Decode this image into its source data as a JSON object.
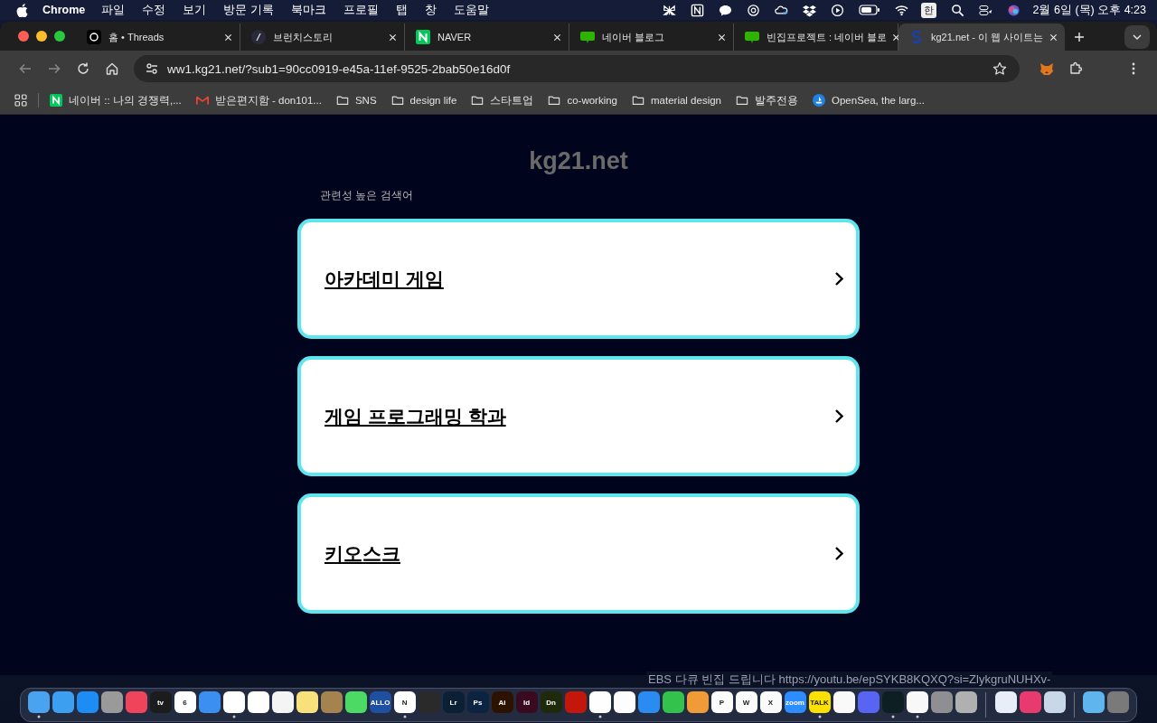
{
  "menu_bar": {
    "app": "Chrome",
    "items": [
      "파일",
      "수정",
      "보기",
      "방문 기록",
      "북마크",
      "프로필",
      "탭",
      "창",
      "도움말"
    ],
    "input_source": "한",
    "clock": "2월 6일 (목) 오후 4:23"
  },
  "tabs": [
    {
      "kind": "threads",
      "title": "홈 • Threads",
      "selected": false
    },
    {
      "kind": "brunch",
      "title": "브런치스토리",
      "selected": false
    },
    {
      "kind": "naver",
      "title": "NAVER",
      "selected": false
    },
    {
      "kind": "blog",
      "title": "네이버 블로그",
      "selected": false
    },
    {
      "kind": "blog",
      "title": "빈집프로젝트 : 네이버 블로",
      "selected": false
    },
    {
      "kind": "site",
      "title": "kg21.net - 이 웹 사이트는",
      "selected": true
    }
  ],
  "address_bar": {
    "url": "ww1.kg21.net/?sub1=90cc0919-e45a-11ef-9525-2bab50e16d0f"
  },
  "bookmarks": [
    {
      "kind": "naver",
      "title": "네이버 :: 나의 경쟁력,..."
    },
    {
      "kind": "gmail",
      "title": "받은편지함 - don101..."
    },
    {
      "kind": "folder",
      "title": "SNS"
    },
    {
      "kind": "folder",
      "title": "design life"
    },
    {
      "kind": "folder",
      "title": "스타트업"
    },
    {
      "kind": "folder",
      "title": "co-working"
    },
    {
      "kind": "folder",
      "title": "material design"
    },
    {
      "kind": "folder",
      "title": "발주전용"
    },
    {
      "kind": "opensea",
      "title": "OpenSea, the larg..."
    }
  ],
  "page": {
    "site_title": "kg21.net",
    "section_label": "관련성 높은 검색어",
    "results": [
      "아카데미 게임",
      "게임 프로그래밍 학과",
      "키오스크"
    ]
  },
  "background_window": {
    "bullet_text": "EBS 다큐 빈집 드립니다 https://youtu.be/epSYKB8KQXQ?si=ZlykgruNUHXv-"
  },
  "dock": {
    "groups": [
      [
        {
          "color": "#4aa3f0",
          "running": true
        },
        {
          "color": "#3d9ff0",
          "running": false
        },
        {
          "color": "#1d8cf5",
          "running": false
        },
        {
          "color": "#9a9a9a",
          "running": false
        },
        {
          "color": "#f0445a",
          "running": false
        },
        {
          "color": "#1c1c1c",
          "label": "tv",
          "running": false
        },
        {
          "color": "#ffffff",
          "label": "6",
          "running": false
        },
        {
          "color": "#3b8ff0",
          "running": false
        },
        {
          "color": "#ffffff",
          "running": true
        },
        {
          "color": "#ffffff",
          "running": false
        },
        {
          "color": "#f4f4f4",
          "running": false
        },
        {
          "color": "#f8e07a",
          "running": false
        },
        {
          "color": "#a5834f",
          "running": false
        },
        {
          "color": "#4cd964",
          "running": false
        },
        {
          "color": "#1f4fa0",
          "label": "ALLO",
          "running": false
        },
        {
          "color": "#ffffff",
          "label": "N",
          "running": true
        },
        {
          "color": "#2a2a2a",
          "running": false
        },
        {
          "color": "#0b2034",
          "label": "Lr",
          "running": false
        },
        {
          "color": "#0b2440",
          "label": "Ps",
          "running": false
        },
        {
          "color": "#2e1200",
          "label": "Ai",
          "running": false
        },
        {
          "color": "#3a0a20",
          "label": "Id",
          "running": false
        },
        {
          "color": "#1f2a0a",
          "label": "Dn",
          "running": false
        },
        {
          "color": "#c4170b",
          "running": false
        },
        {
          "color": "#fefefe",
          "running": true
        },
        {
          "color": "#fdfdfd",
          "running": false
        },
        {
          "color": "#2a8bf0",
          "running": false
        },
        {
          "color": "#33c24b",
          "running": false
        },
        {
          "color": "#f19a38",
          "running": false
        },
        {
          "color": "#fcfcfc",
          "label": "P",
          "running": false
        },
        {
          "color": "#fbfbfb",
          "label": "W",
          "running": false
        },
        {
          "color": "#fafafa",
          "label": "X",
          "running": false
        },
        {
          "color": "#2d8cff",
          "label": "zoom",
          "running": false
        },
        {
          "color": "#fae100",
          "label": "TALK",
          "running": true
        },
        {
          "color": "#f9f9f9",
          "running": false
        },
        {
          "color": "#5865f2",
          "running": false
        },
        {
          "color": "#0d1f22",
          "running": true
        },
        {
          "color": "#f8f8f8",
          "running": true
        },
        {
          "color": "#8e8e93",
          "running": false
        },
        {
          "color": "#b0b0b0",
          "running": false
        }
      ],
      [
        {
          "color": "#e8eef8",
          "running": false
        },
        {
          "color": "#e83a6f",
          "running": false
        },
        {
          "color": "#c8d8e8",
          "running": false
        }
      ],
      [
        {
          "color": "#5fb6ee",
          "running": false
        },
        {
          "color": "#7a7a7a",
          "running": false
        }
      ]
    ]
  }
}
